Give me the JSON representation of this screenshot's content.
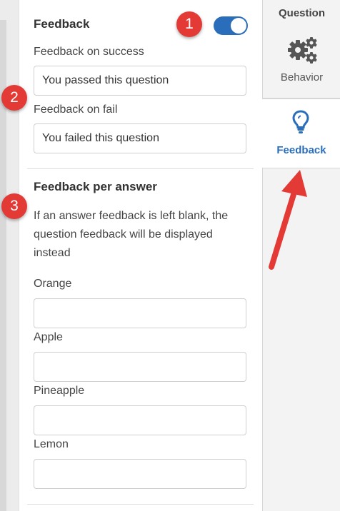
{
  "panel": {
    "feedback_title": "Feedback",
    "toggle_on": true,
    "success": {
      "label": "Feedback on success",
      "value": "You passed this question"
    },
    "fail": {
      "label": "Feedback on fail",
      "value": "You failed this question"
    },
    "per_answer": {
      "title": "Feedback per answer",
      "help": "If an answer feedback is left blank, the question feedback will be displayed instead",
      "answers": [
        {
          "label": "Orange",
          "value": ""
        },
        {
          "label": "Apple",
          "value": ""
        },
        {
          "label": "Pineapple",
          "value": ""
        },
        {
          "label": "Lemon",
          "value": ""
        }
      ]
    }
  },
  "side_tabs": {
    "heading": "Question",
    "behavior_label": "Behavior",
    "behavior_icon": "gears-icon",
    "feedback_label": "Feedback",
    "feedback_icon": "lightbulb-icon"
  },
  "annotations": {
    "badges": [
      "1",
      "2",
      "3"
    ],
    "badge_color": "#e43a36",
    "arrow_color": "#e43a36"
  },
  "colors": {
    "accent": "#2a6ebb",
    "border": "#cfcfcf"
  }
}
